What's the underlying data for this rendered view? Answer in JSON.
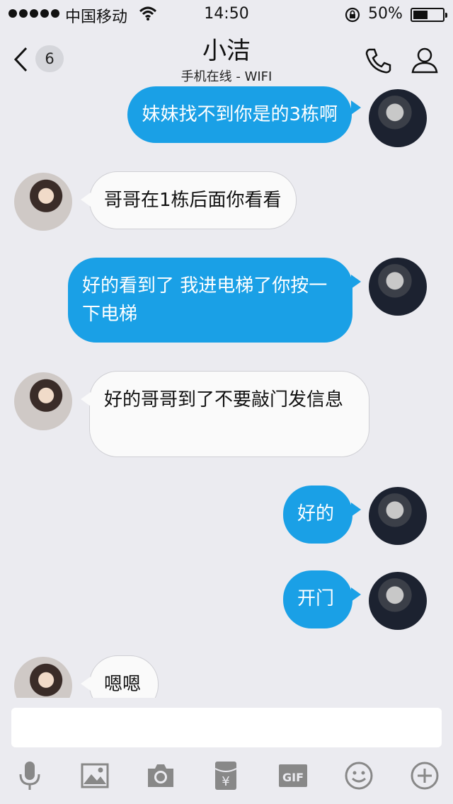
{
  "status": {
    "carrier": "中国移动",
    "time": "14:50",
    "battery_text": "50%",
    "battery_level": 0.5
  },
  "header": {
    "back_count": "6",
    "title": "小洁",
    "subtitle": "手机在线 - WIFI"
  },
  "messages": [
    {
      "from": "me",
      "text": "妹妹找不到你是的3栋啊"
    },
    {
      "from": "her",
      "text": "哥哥在1栋后面你看看"
    },
    {
      "from": "me",
      "text": "好的看到了 我进电梯了你按一下电梯"
    },
    {
      "from": "her",
      "text": "好的哥哥到了不要敲门发信息"
    },
    {
      "from": "me",
      "text": "好的"
    },
    {
      "from": "me",
      "text": "开门"
    },
    {
      "from": "her",
      "text": "嗯嗯"
    }
  ],
  "input": {
    "placeholder": ""
  },
  "toolbar": {
    "icons": [
      "microphone-icon",
      "image-icon",
      "camera-icon",
      "red-packet-icon",
      "gif-icon",
      "emoji-icon",
      "plus-icon"
    ],
    "gif_label": "GIF",
    "yuan_symbol": "¥"
  },
  "colors": {
    "outgoing_bubble": "#1aa0e6",
    "incoming_bubble": "#fafafa",
    "background": "#ebebf0"
  }
}
